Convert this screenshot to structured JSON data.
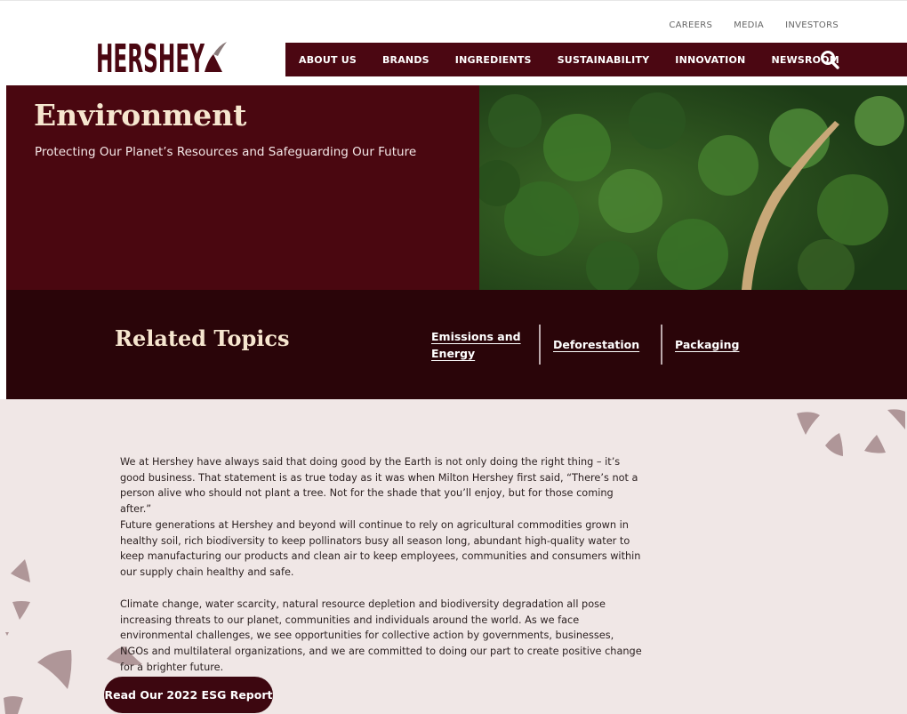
{
  "header": {
    "logo_text": "HERSHEY",
    "utility_nav": [
      "CAREERS",
      "MEDIA",
      "INVESTORS"
    ],
    "main_nav": [
      "ABOUT US",
      "BRANDS",
      "INGREDIENTS",
      "SUSTAINABILITY",
      "INNOVATION",
      "NEWSROOM"
    ]
  },
  "hero": {
    "title": "Environment",
    "subtitle": "Protecting Our Planet’s Resources and Safeguarding Our Future"
  },
  "related": {
    "title": "Related Topics",
    "topics": [
      {
        "line1": "Emissions and",
        "line2": "Energy"
      },
      {
        "line1": "Deforestation"
      },
      {
        "line1": "Packaging"
      }
    ]
  },
  "body": {
    "paragraphs": [
      "We at Hershey have always said that doing good by the Earth is not only doing the right thing – it’s good business. That statement is as true today as it was when Milton Hershey first said, “There’s not a person alive who should not plant a tree. Not for the shade that you’ll enjoy, but for those coming after.”",
      "Future generations at Hershey and beyond will continue to rely on agricultural commodities grown in healthy soil, rich biodiversity to keep pollinators busy all season long, abundant high-quality water to keep manufacturing our products and clean air to keep employees, communities and consumers within our supply chain healthy and safe.",
      "Climate change, water scarcity, natural resource depletion and biodiversity degradation all pose increasing threats to our planet, communities and individuals around the world.  As we face environmental challenges, we see opportunities for collective action by governments, businesses, NGOs and multilateral organizations, and we are committed to doing our part to create positive change for a brighter future."
    ],
    "cta_label": "Read Our 2022 ESG Report"
  },
  "colors": {
    "brand_maroon": "#4b0712",
    "dark_maroon": "#2a0509",
    "cream": "#f6e6cf",
    "body_bg": "#f0e7e6"
  },
  "icons": [
    "search-icon",
    "hershey-kiss-logo-icon"
  ]
}
